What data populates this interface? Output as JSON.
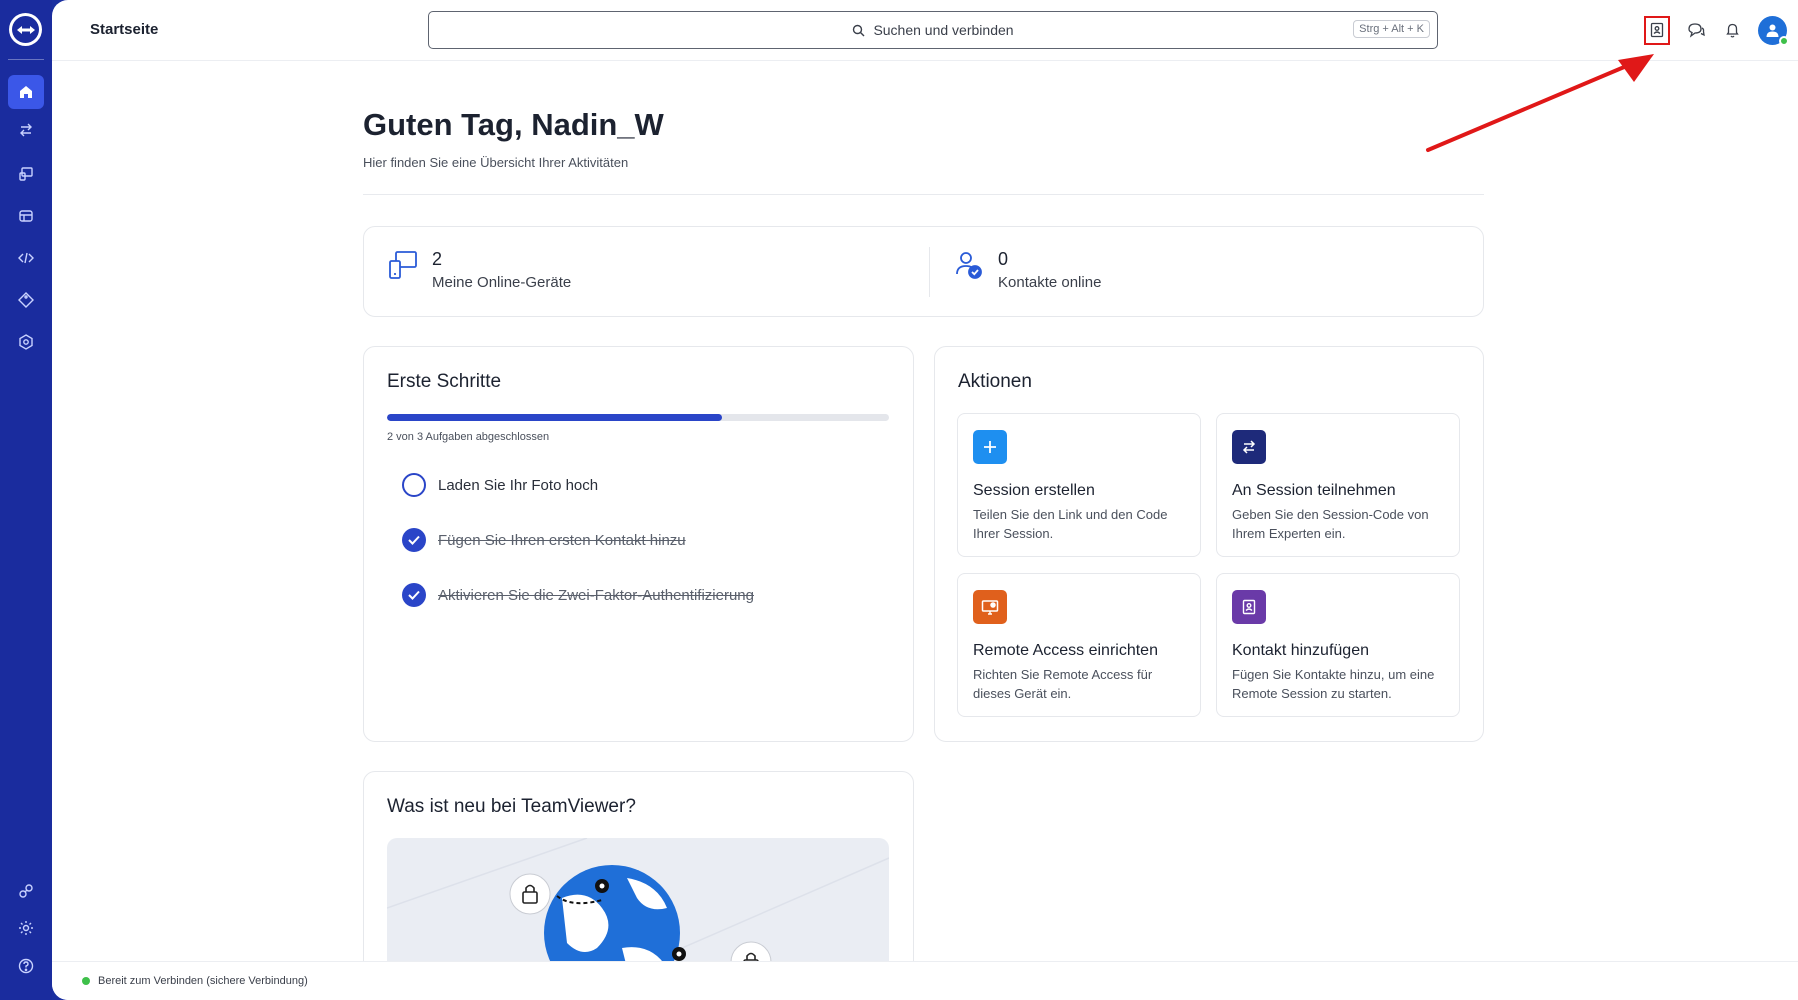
{
  "sidebar": {
    "items": [
      {
        "icon": "home-icon",
        "active": true
      },
      {
        "icon": "swap-arrows-icon"
      },
      {
        "icon": "devices-icon"
      },
      {
        "icon": "stack-icon"
      },
      {
        "icon": "code-icon"
      },
      {
        "icon": "tag-icon"
      },
      {
        "icon": "shield-gear-icon"
      }
    ],
    "bottom_items": [
      {
        "icon": "integrations-icon"
      },
      {
        "icon": "settings-icon"
      },
      {
        "icon": "help-icon"
      }
    ]
  },
  "header": {
    "title": "Startseite",
    "search_placeholder": "Suchen und verbinden",
    "search_shortcut": "Strg + Alt + K"
  },
  "greeting": {
    "title": "Guten Tag, Nadin_W",
    "subtitle": "Hier finden Sie eine Übersicht Ihrer Aktivitäten"
  },
  "stats": [
    {
      "value": "2",
      "label": "Meine Online-Geräte",
      "icon": "devices-icon"
    },
    {
      "value": "0",
      "label": "Kontakte online",
      "icon": "contact-check-icon"
    }
  ],
  "onboarding": {
    "title": "Erste Schritte",
    "progress_text": "2 von 3 Aufgaben abgeschlossen",
    "progress": 0.667,
    "tasks": [
      {
        "label": "Laden Sie Ihr Foto hoch",
        "done": false
      },
      {
        "label": "Fügen Sie Ihren ersten Kontakt hinzu",
        "done": true
      },
      {
        "label": "Aktivieren Sie die Zwei-Faktor-Authentifizierung",
        "done": true
      }
    ]
  },
  "actions": {
    "title": "Aktionen",
    "items": [
      {
        "title": "Session erstellen",
        "desc": "Teilen Sie den Link und den Code Ihrer Session.",
        "color": "#1e8ff0",
        "icon": "plus-icon"
      },
      {
        "title": "An Session teilnehmen",
        "desc": "Geben Sie den Session-Code von Ihrem Experten ein.",
        "color": "#1e2a7a",
        "icon": "swap-arrows-icon"
      },
      {
        "title": "Remote Access einrichten",
        "desc": "Richten Sie Remote Access für dieses Gerät ein.",
        "color": "#e0601c",
        "icon": "monitor-gear-icon"
      },
      {
        "title": "Kontakt hinzufügen",
        "desc": "Fügen Sie Kontakte hinzu, um eine Remote Session zu starten.",
        "color": "#6a3aa8",
        "icon": "contact-book-icon"
      }
    ]
  },
  "news": {
    "title": "Was ist neu bei TeamViewer?"
  },
  "footer": {
    "status": "Bereit zum Verbinden (sichere Verbindung)"
  }
}
